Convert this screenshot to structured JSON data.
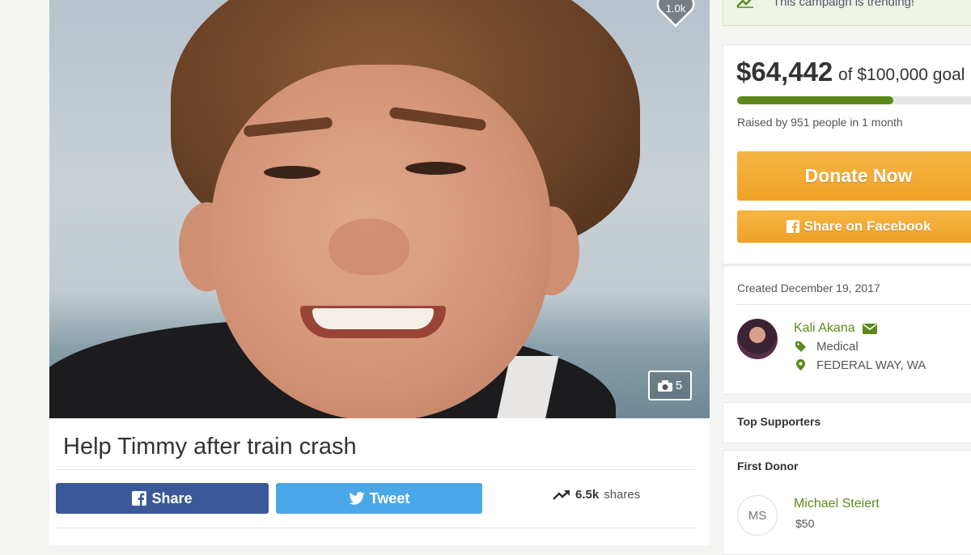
{
  "hero": {
    "likes": "1.0k",
    "photo_count": "5"
  },
  "campaign": {
    "title": "Help Timmy after train crash"
  },
  "share_bar": {
    "facebook_label": "Share",
    "tweet_label": "Tweet",
    "shares_count": "6.5k",
    "shares_label": "shares"
  },
  "sidebar": {
    "trending_text": "This campaign is trending!",
    "raised_amount": "$64,442",
    "goal_text": "of $100,000 goal",
    "progress_percent": 64.4,
    "raised_by": "Raised by 951 people in 1 month",
    "donate_label": "Donate Now",
    "facebook_label": "Share on Facebook",
    "created": "Created December 19, 2017",
    "organizer": {
      "name": "Kali Akana",
      "category": "Medical",
      "location": "FEDERAL WAY, WA"
    },
    "top_supporters_label": "Top Supporters",
    "first_donor_label": "First Donor",
    "first_donor": {
      "initials": "MS",
      "name": "Michael Steiert",
      "amount": "$50"
    }
  },
  "colors": {
    "facebook": "#3b5998",
    "twitter": "#4aa8e8",
    "donate": "#f0a62a",
    "progress": "#5c8a1a",
    "accent_green": "#5c8a1a"
  }
}
